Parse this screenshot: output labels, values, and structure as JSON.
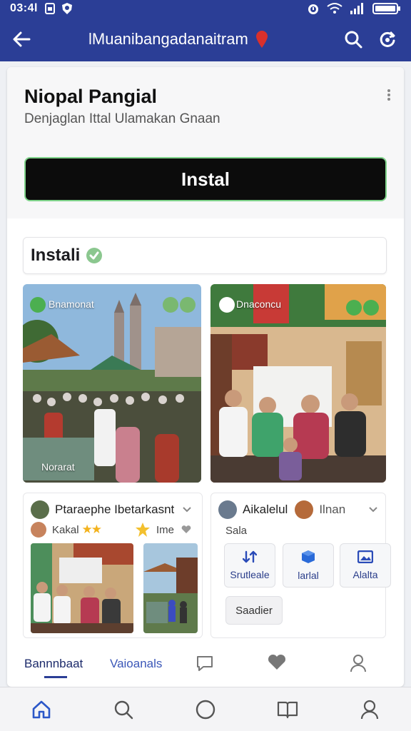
{
  "status_bar": {
    "time": "03:4l",
    "colors": {
      "bar_bg": "#2b3e96"
    },
    "icons": [
      "sim-icon",
      "shield-icon",
      "alarm-icon",
      "wifi-icon",
      "signal-icon",
      "battery-icon"
    ]
  },
  "app_bar": {
    "title": "lMuanibangadanaitram",
    "icons": [
      "back-arrow-icon",
      "location-pin-icon",
      "search-icon",
      "refresh-icon"
    ]
  },
  "listing": {
    "app_name": "Niopal Pangial",
    "subtitle": "Denjaglan Ittal Ulamakan Gnaan",
    "install_label": "Instal",
    "colors": {
      "install_bg": "#0c0c0c",
      "install_border": "#7fd38a"
    }
  },
  "section": {
    "title": "Instali",
    "icon": "check-circle-icon"
  },
  "photos": [
    {
      "label": "Bnamonat",
      "caption": "Norarat"
    },
    {
      "label": "Dnaconcu",
      "caption": ""
    }
  ],
  "left_card": {
    "author": "Ptaraephe Ibetarkasnt",
    "rating_label": "Kakal",
    "stars": "★★",
    "tag_label": "Ime",
    "icons": [
      "avatar",
      "chevron-down-icon",
      "star-icon",
      "heart-icon"
    ]
  },
  "right_card": {
    "author": "Aikalelul",
    "author2": "Ilnan",
    "section_label": "Sala",
    "tiles": [
      {
        "label": "Srutleale",
        "icon": "arrows-icon"
      },
      {
        "label": "larlal",
        "icon": "cube-icon"
      },
      {
        "label": "Alalta",
        "icon": "image-icon"
      }
    ],
    "chip_label": "Saadier"
  },
  "inner_tabs": [
    {
      "label": "Bannnbaat"
    },
    {
      "label": "Vaioanals"
    },
    {
      "icon": "chat-icon"
    },
    {
      "icon": "heart-icon"
    },
    {
      "icon": "person-icon"
    }
  ],
  "bottom_nav": [
    {
      "icon": "home-icon"
    },
    {
      "icon": "search-icon"
    },
    {
      "icon": "circle-icon"
    },
    {
      "icon": "book-icon"
    },
    {
      "icon": "profile-icon"
    }
  ]
}
